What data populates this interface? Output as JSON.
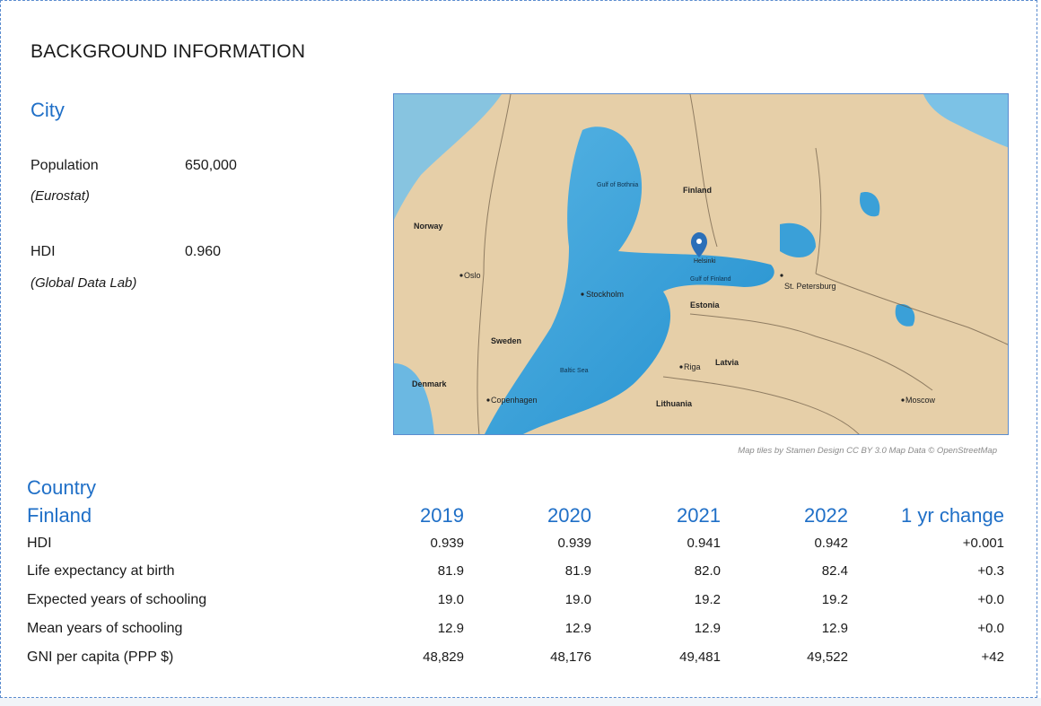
{
  "section_title": "BACKGROUND INFORMATION",
  "city": {
    "heading": "City",
    "stats": [
      {
        "label": "Population",
        "source": "(Eurostat)",
        "value": "650,000"
      },
      {
        "label": "HDI",
        "source": "(Global Data Lab)",
        "value": "0.960"
      }
    ]
  },
  "map": {
    "labels": {
      "finland": "Finland",
      "norway": "Norway",
      "sweden": "Sweden",
      "estonia": "Estonia",
      "latvia": "Latvia",
      "lithuania": "Lithuania",
      "denmark": "Denmark",
      "oslo": "Oslo",
      "stockholm": "Stockholm",
      "copenhagen": "Copenhagen",
      "riga": "Riga",
      "st_petersburg": "St. Petersburg",
      "moscow": "Moscow",
      "helsinki": "Helsinki",
      "gulf_bothnia": "Gulf of Bothnia",
      "gulf_finland": "Gulf of Finland",
      "baltic_sea": "Baltic Sea"
    },
    "credit": "Map tiles by Stamen Design CC BY 3.0 Map Data © OpenStreetMap",
    "colors": {
      "land": "#e6cfa8",
      "water": "#3aa0d8",
      "pin": "#2b6fb8"
    }
  },
  "country": {
    "heading": "Country",
    "name": "Finland",
    "years": [
      "2019",
      "2020",
      "2021",
      "2022",
      "1 yr change"
    ],
    "rows": [
      {
        "label": "HDI",
        "values": [
          "0.939",
          "0.939",
          "0.941",
          "0.942",
          "+0.001"
        ]
      },
      {
        "label": "Life expectancy at birth",
        "values": [
          "81.9",
          "81.9",
          "82.0",
          "82.4",
          "+0.3"
        ]
      },
      {
        "label": "Expected years of schooling",
        "values": [
          "19.0",
          "19.0",
          "19.2",
          "19.2",
          "+0.0"
        ]
      },
      {
        "label": "Mean years of schooling",
        "values": [
          "12.9",
          "12.9",
          "12.9",
          "12.9",
          "+0.0"
        ]
      },
      {
        "label": "GNI per capita (PPP $)",
        "values": [
          "48,829",
          "48,176",
          "49,481",
          "49,522",
          "+42"
        ]
      }
    ]
  }
}
